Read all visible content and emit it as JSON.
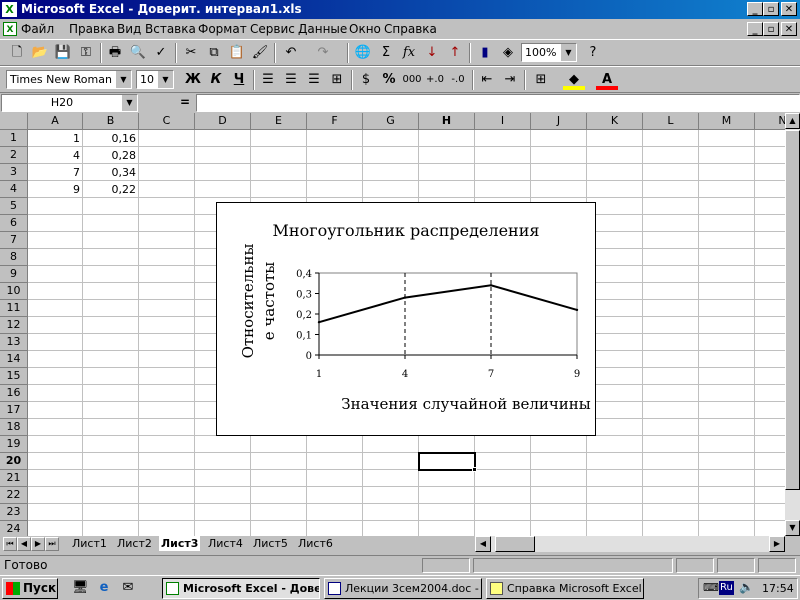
{
  "window": {
    "title": "Microsoft Excel - Доверит. интервал1.xls",
    "app_icon": "X",
    "controls": [
      "_",
      "▫",
      "✕"
    ],
    "doc_controls": [
      "_",
      "▫",
      "✕"
    ]
  },
  "menu": [
    "Файл",
    "Правка",
    "Вид",
    "Вставка",
    "Формат",
    "Сервис",
    "Данные",
    "Окно",
    "Справка"
  ],
  "toolbar": {
    "zoom": "100%",
    "sum_symbol": "Σ",
    "fx_symbol": "fx"
  },
  "format_toolbar": {
    "font_name": "Times New Roman Cyr",
    "font_size": "10",
    "bold": "Ж",
    "italic": "К",
    "underline": "Ч",
    "percent": "%",
    "thousands": "000"
  },
  "formula_bar": {
    "cell_ref": "H20",
    "equals": "=",
    "content": ""
  },
  "grid": {
    "columns": [
      "A",
      "B",
      "C",
      "D",
      "E",
      "F",
      "G",
      "H",
      "I",
      "J",
      "K",
      "L",
      "M",
      "N"
    ],
    "rows": [
      "1",
      "2",
      "3",
      "4",
      "5",
      "6",
      "7",
      "8",
      "9",
      "10",
      "11",
      "12",
      "13",
      "14",
      "15",
      "16",
      "17",
      "18",
      "19",
      "20",
      "21",
      "22",
      "23",
      "24"
    ],
    "active_column": "H",
    "active_row": "20",
    "cells": [
      {
        "col": "A",
        "row": 1,
        "value": "1"
      },
      {
        "col": "B",
        "row": 1,
        "value": "0,16"
      },
      {
        "col": "A",
        "row": 2,
        "value": "4"
      },
      {
        "col": "B",
        "row": 2,
        "value": "0,28"
      },
      {
        "col": "A",
        "row": 3,
        "value": "7"
      },
      {
        "col": "B",
        "row": 3,
        "value": "0,34"
      },
      {
        "col": "A",
        "row": 4,
        "value": "9"
      },
      {
        "col": "B",
        "row": 4,
        "value": "0,22"
      }
    ]
  },
  "chart_data": {
    "type": "line",
    "title": "Многоугольник распределения",
    "xlabel": "Значения случайной величины",
    "ylabel_lines": [
      "Относительны",
      "е частоты"
    ],
    "categories": [
      "1",
      "4",
      "7",
      "9"
    ],
    "values": [
      0.16,
      0.28,
      0.34,
      0.22
    ],
    "y_ticks": [
      "0,4",
      "0,3",
      "0,2",
      "0,1",
      "0"
    ],
    "ylim": [
      0,
      0.4
    ],
    "grid": false,
    "drop_lines": true,
    "legend": "none"
  },
  "sheets": {
    "tabs": [
      "Лист1",
      "Лист2",
      "Лист3",
      "Лист4",
      "Лист5",
      "Лист6"
    ],
    "active": "Лист3"
  },
  "status": {
    "text": "Готово"
  },
  "taskbar": {
    "start": "Пуск",
    "tasks": [
      {
        "label": "Microsoft Excel - Дове...",
        "active": true
      },
      {
        "label": "Лекции 3сем2004.doc - ...",
        "active": false
      },
      {
        "label": "Справка Microsoft Excel",
        "active": false
      }
    ],
    "lang": "Ru",
    "clock": "17:54"
  }
}
